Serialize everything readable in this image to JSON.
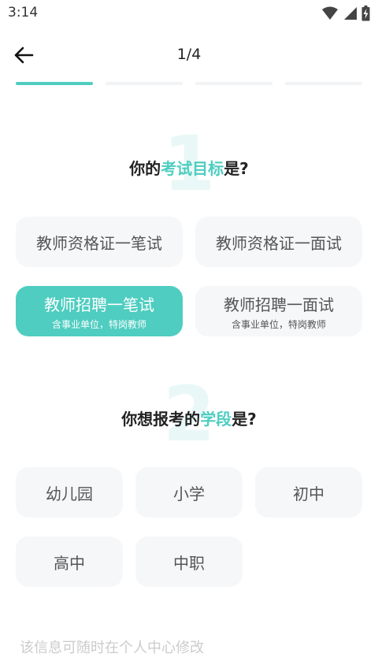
{
  "status": {
    "time": "3:14"
  },
  "nav": {
    "step": "1/4"
  },
  "progress": {
    "current": 1,
    "total": 4
  },
  "section1": {
    "number": "1",
    "prefix": "你的",
    "highlight": "考试目标",
    "suffix": "是?",
    "options": [
      {
        "main": "教师资格证一笔试",
        "sub": ""
      },
      {
        "main": "教师资格证一面试",
        "sub": ""
      },
      {
        "main": "教师招聘一笔试",
        "sub": "含事业单位，特岗教师"
      },
      {
        "main": "教师招聘一面试",
        "sub": "含事业单位，特岗教师"
      }
    ],
    "selected_index": 2
  },
  "section2": {
    "number": "2",
    "prefix": "你想报考的",
    "highlight": "学段",
    "suffix": "是?",
    "options": [
      "幼儿园",
      "小学",
      "初中",
      "高中",
      "中职"
    ]
  },
  "footer": {
    "note": "该信息可随时在个人中心修改"
  },
  "colors": {
    "accent": "#4ecdc0",
    "option_bg": "#f6f7f9"
  },
  "icons": {
    "back": "arrow-left-icon",
    "wifi": "wifi-icon",
    "signal": "signal-icon",
    "battery": "battery-charging-icon"
  }
}
